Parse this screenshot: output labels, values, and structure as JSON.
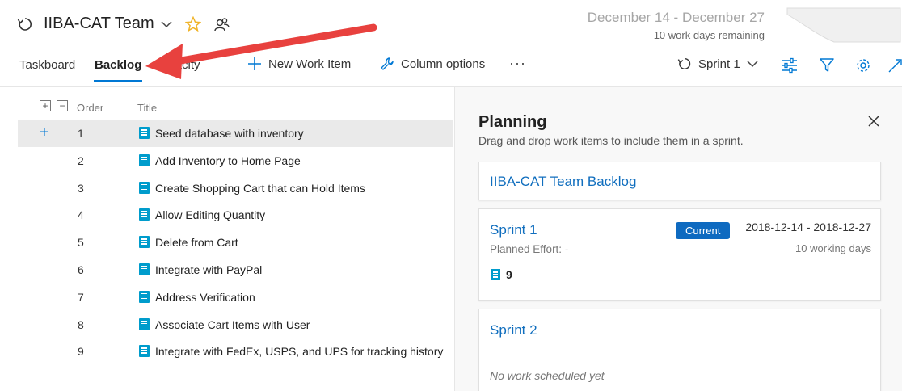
{
  "header": {
    "team_name": "IIBA-CAT Team",
    "sprint_range": "December 14 - December 27",
    "work_days_remaining": "10 work days remaining"
  },
  "nav": {
    "tabs": [
      {
        "label": "Taskboard"
      },
      {
        "label": "Backlog"
      },
      {
        "label": "apacity"
      }
    ],
    "new_work_item": "New Work Item",
    "column_options": "Column options",
    "more": "···",
    "sprint_selector": "Sprint 1"
  },
  "grid": {
    "col_order": "Order",
    "col_title": "Title",
    "rows": [
      {
        "order": "1",
        "title": "Seed database with inventory"
      },
      {
        "order": "2",
        "title": "Add Inventory to Home Page"
      },
      {
        "order": "3",
        "title": "Create Shopping Cart that can Hold Items"
      },
      {
        "order": "4",
        "title": "Allow Editing Quantity"
      },
      {
        "order": "5",
        "title": "Delete from Cart"
      },
      {
        "order": "6",
        "title": "Integrate with PayPal"
      },
      {
        "order": "7",
        "title": "Address Verification"
      },
      {
        "order": "8",
        "title": "Associate Cart Items with User"
      },
      {
        "order": "9",
        "title": "Integrate with FedEx, USPS, and UPS for tracking history"
      }
    ]
  },
  "planning": {
    "title": "Planning",
    "subtitle": "Drag and drop work items to include them in a sprint.",
    "backlog_link": "IIBA-CAT Team Backlog",
    "sprint1": {
      "name": "Sprint 1",
      "badge": "Current",
      "dates": "2018-12-14 - 2018-12-27",
      "effort": "Planned Effort: -",
      "days": "10 working days",
      "count": "9"
    },
    "sprint2": {
      "name": "Sprint 2",
      "empty": "No work scheduled yet"
    }
  },
  "colors": {
    "accent": "#0078d4",
    "link": "#106ebe",
    "work_item": "#009ccc",
    "badge": "#0e6ac0",
    "annotation_arrow": "#e8413e",
    "star": "#f0b429"
  }
}
